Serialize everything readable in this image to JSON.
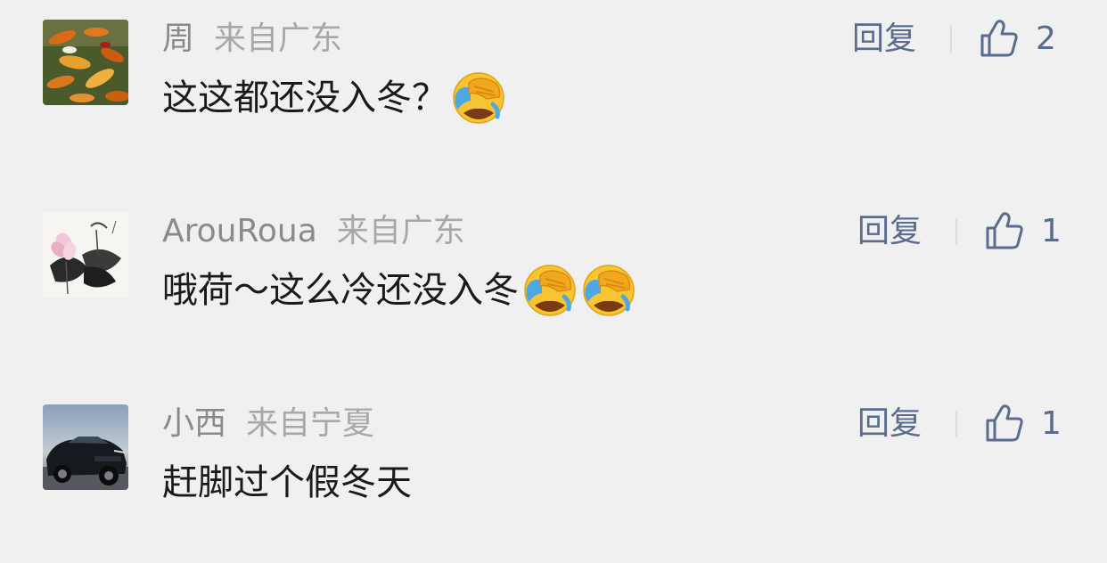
{
  "comments": [
    {
      "user": "周",
      "location": "来自广东",
      "text": "这这都还没入冬？",
      "emoji_count": 1,
      "emoji_name": "facepalm-laugh-cry",
      "reply_label": "回复",
      "likes": "2",
      "avatar": "goldfish"
    },
    {
      "user": "ArouRoua",
      "location": "来自广东",
      "text": "哦荷～这么冷还没入冬",
      "emoji_count": 2,
      "emoji_name": "facepalm-laugh-cry",
      "reply_label": "回复",
      "likes": "1",
      "avatar": "lotus-painting"
    },
    {
      "user": "小西",
      "location": "来自宁夏",
      "text": "赶脚过个假冬天",
      "emoji_count": 0,
      "reply_label": "回复",
      "likes": "1",
      "avatar": "car"
    }
  ],
  "colors": {
    "background": "#f0f0f0",
    "username": "#8a8a8a",
    "location": "#a8a8a8",
    "body_text": "#1a1a1a",
    "action_blue": "#5a6b8c"
  }
}
